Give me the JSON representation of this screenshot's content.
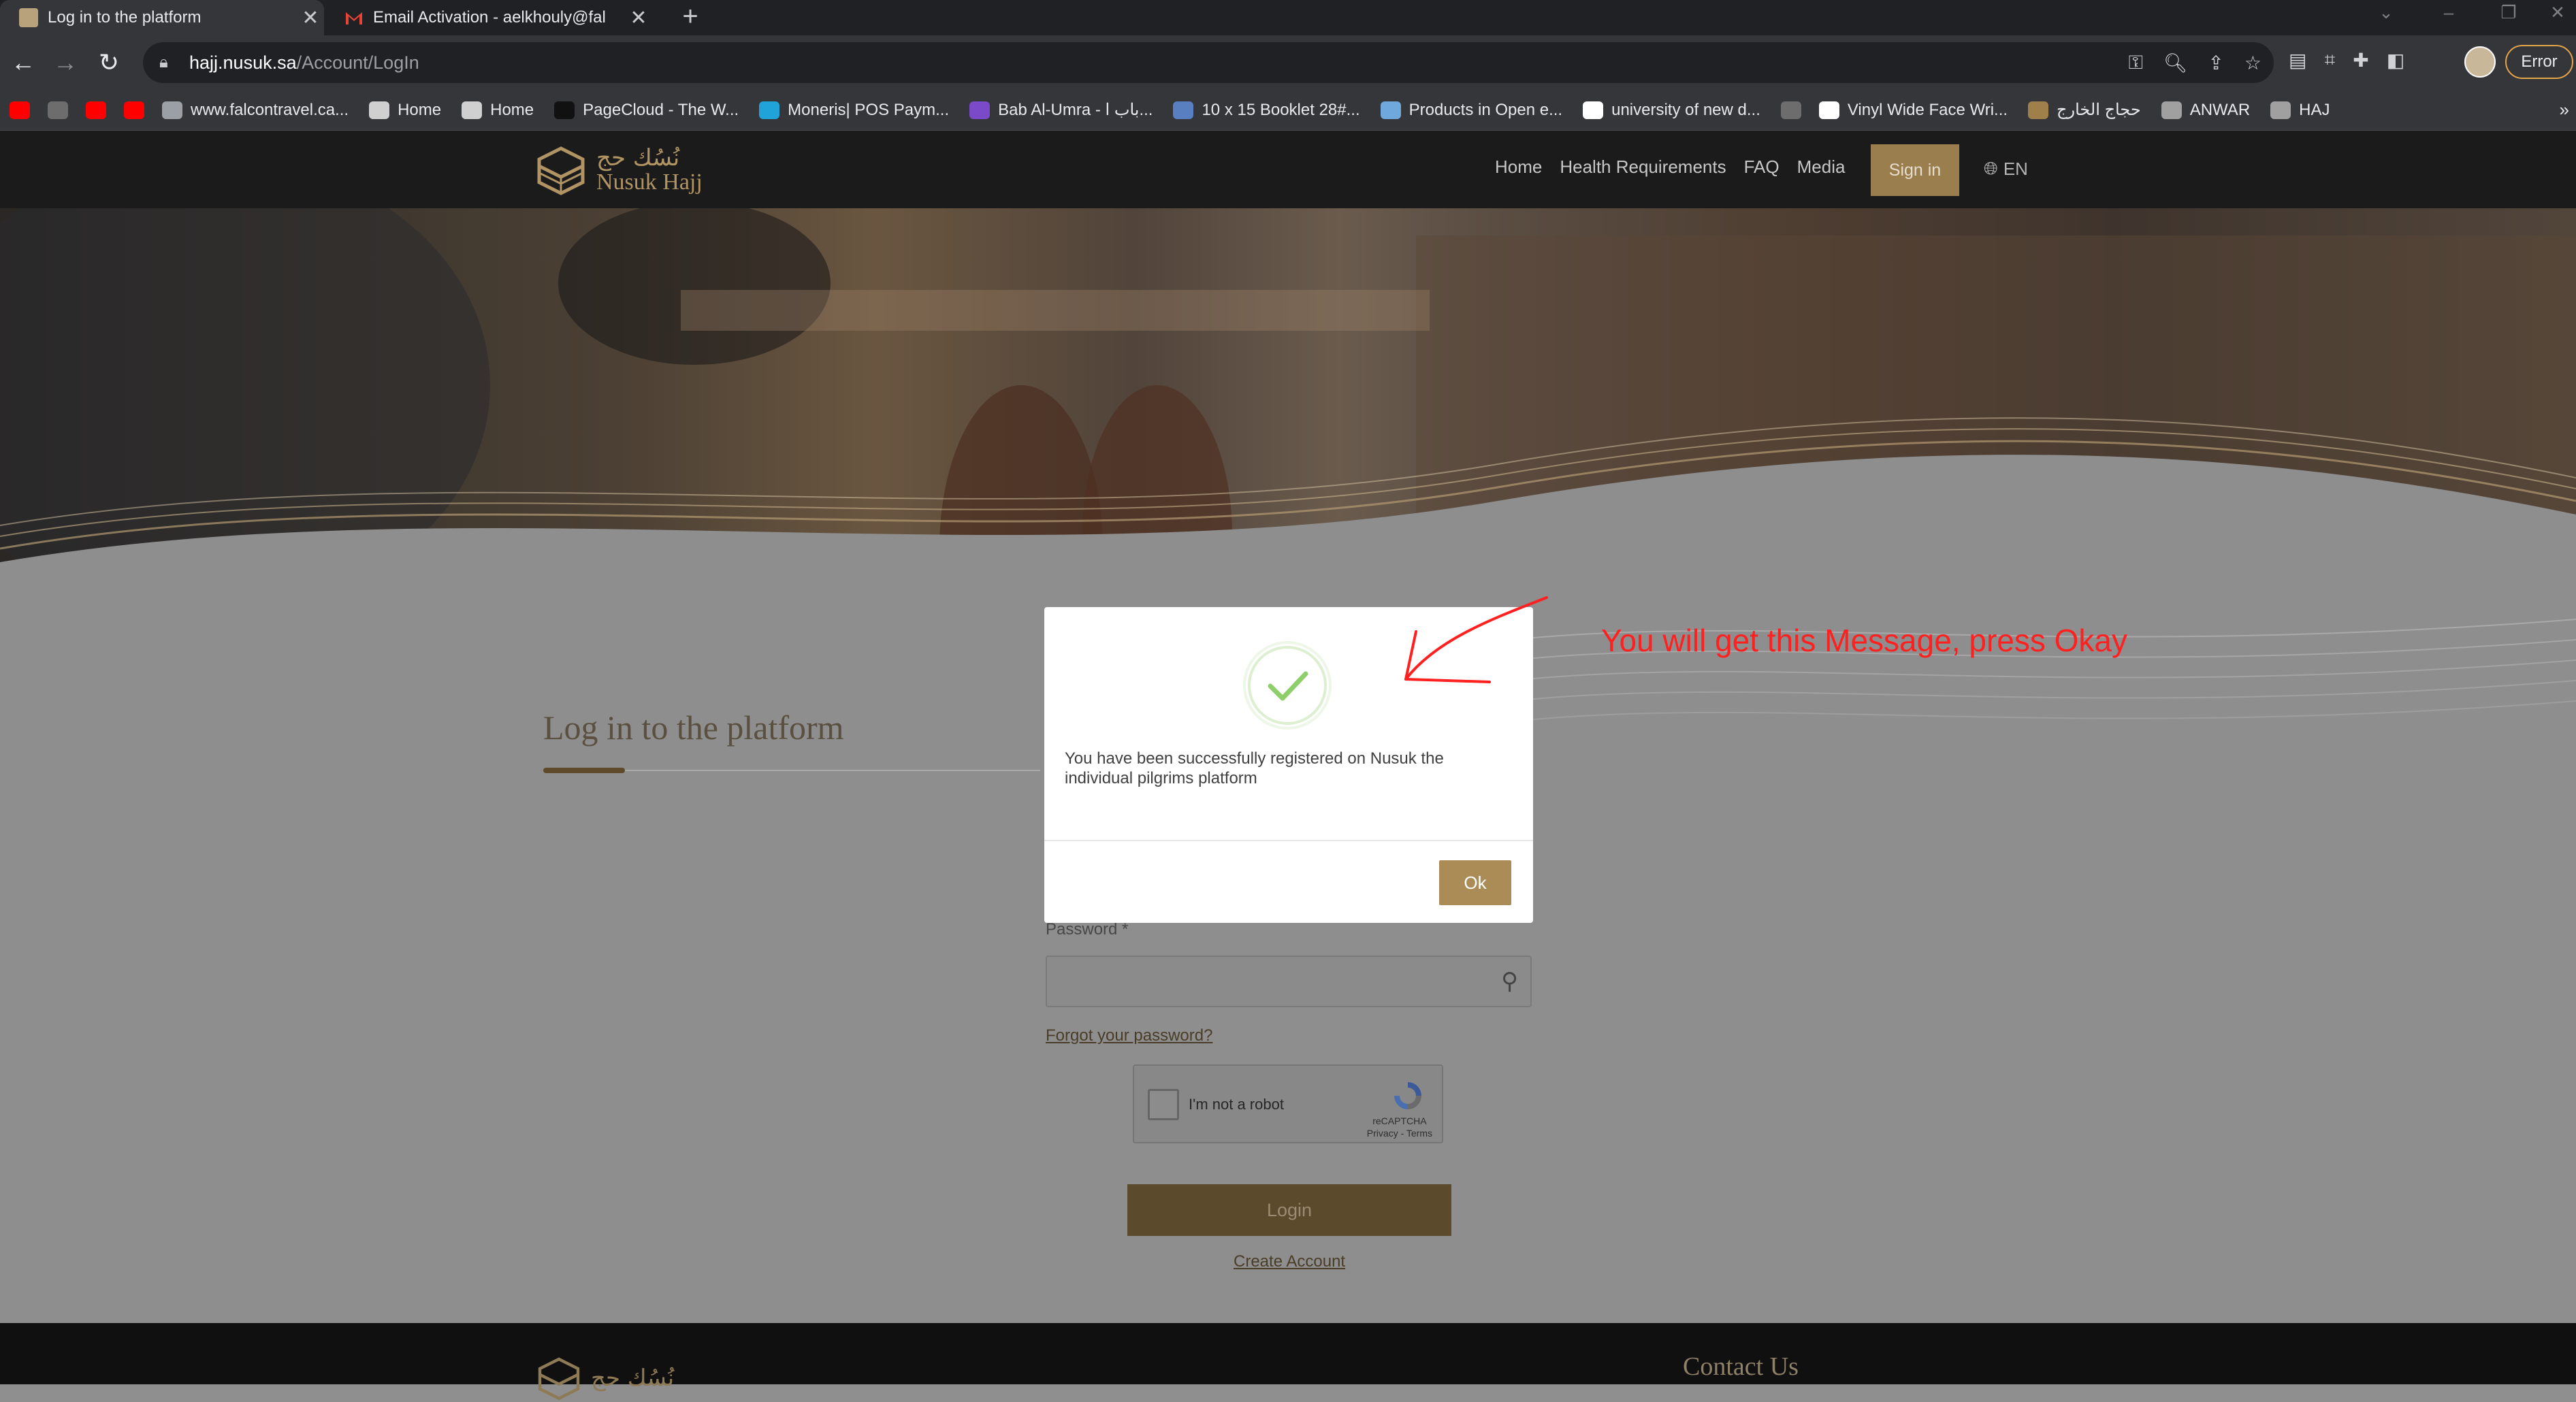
{
  "browser": {
    "tabs": [
      {
        "title": "Log in to the platform",
        "favicon_color": "#b8a27c",
        "active": true
      },
      {
        "title": "Email Activation - aelkhouly@fal",
        "favicon_color": "#ea4335",
        "active": false
      }
    ],
    "new_tab_label": "+",
    "close_label": "✕",
    "url_host": "hajj.nusuk.sa",
    "url_path": "/Account/LogIn",
    "profile_status": "Error",
    "bookmarks": [
      {
        "label": "",
        "icon": "youtube-icon",
        "color": "#ff0000"
      },
      {
        "label": "",
        "icon": "bookmark-icon",
        "color": "#6d6d6d"
      },
      {
        "label": "",
        "icon": "youtube-icon",
        "color": "#ff0000"
      },
      {
        "label": "",
        "icon": "youtube-icon",
        "color": "#ff0000"
      },
      {
        "label": "www.falcontravel.ca...",
        "icon": "globe-icon",
        "color": "#9aa0a6"
      },
      {
        "label": "Home",
        "icon": "roblox-icon",
        "color": "#d0d0d0"
      },
      {
        "label": "Home",
        "icon": "roblox-icon",
        "color": "#d0d0d0"
      },
      {
        "label": "PageCloud - The W...",
        "icon": "pagecloud-icon",
        "color": "#111111"
      },
      {
        "label": "Moneris| POS Paym...",
        "icon": "moneris-icon",
        "color": "#1fa3d8"
      },
      {
        "label": "Bab Al-Umra - باب ا...",
        "icon": "bab-icon",
        "color": "#7a4ac8"
      },
      {
        "label": "10 x 15 Booklet 28#...",
        "icon": "booklet-icon",
        "color": "#5a7fc0"
      },
      {
        "label": "Products in Open e...",
        "icon": "products-icon",
        "color": "#6fa8dc"
      },
      {
        "label": "university of new d...",
        "icon": "google-icon",
        "color": "#ffffff"
      },
      {
        "label": "",
        "icon": "bookmark-icon",
        "color": "#6d6d6d"
      },
      {
        "label": "Vinyl Wide Face Wri...",
        "icon": "vinyl-icon",
        "color": "#ffffff"
      },
      {
        "label": "حجاج الخارج",
        "icon": "hajj-icon",
        "color": "#a0804a"
      },
      {
        "label": "ANWAR",
        "icon": "nusuk-icon",
        "color": "#a0a0a0"
      },
      {
        "label": "HAJ",
        "icon": "nusuk-icon",
        "color": "#a0a0a0"
      }
    ],
    "bookmarks_more": "»"
  },
  "site": {
    "logo_ar": "نُسُك حج",
    "logo_en": "Nusuk Hajj",
    "nav": [
      "Home",
      "Health Requirements",
      "FAQ",
      "Media"
    ],
    "signin_label": "Sign in",
    "language": "EN",
    "brand_color": "#ab8c57"
  },
  "login": {
    "heading": "Log in to the platform",
    "password_label": "Password *",
    "forgot_label": "Forgot your password?",
    "captcha_label": "I'm not a robot",
    "captcha_brand": "reCAPTCHA",
    "captcha_links": "Privacy - Terms",
    "login_label": "Login",
    "create_label": "Create Account"
  },
  "footer": {
    "contact_heading": "Contact Us",
    "logo_ar": "نُسُك حج"
  },
  "modal": {
    "message": "You have been successfully registered on Nusuk the individual pilgrims platform",
    "ok_label": "Ok",
    "icon": "success-check-icon"
  },
  "annotation": {
    "text": "You will get this Message, press Okay",
    "color": "#ff2020"
  }
}
